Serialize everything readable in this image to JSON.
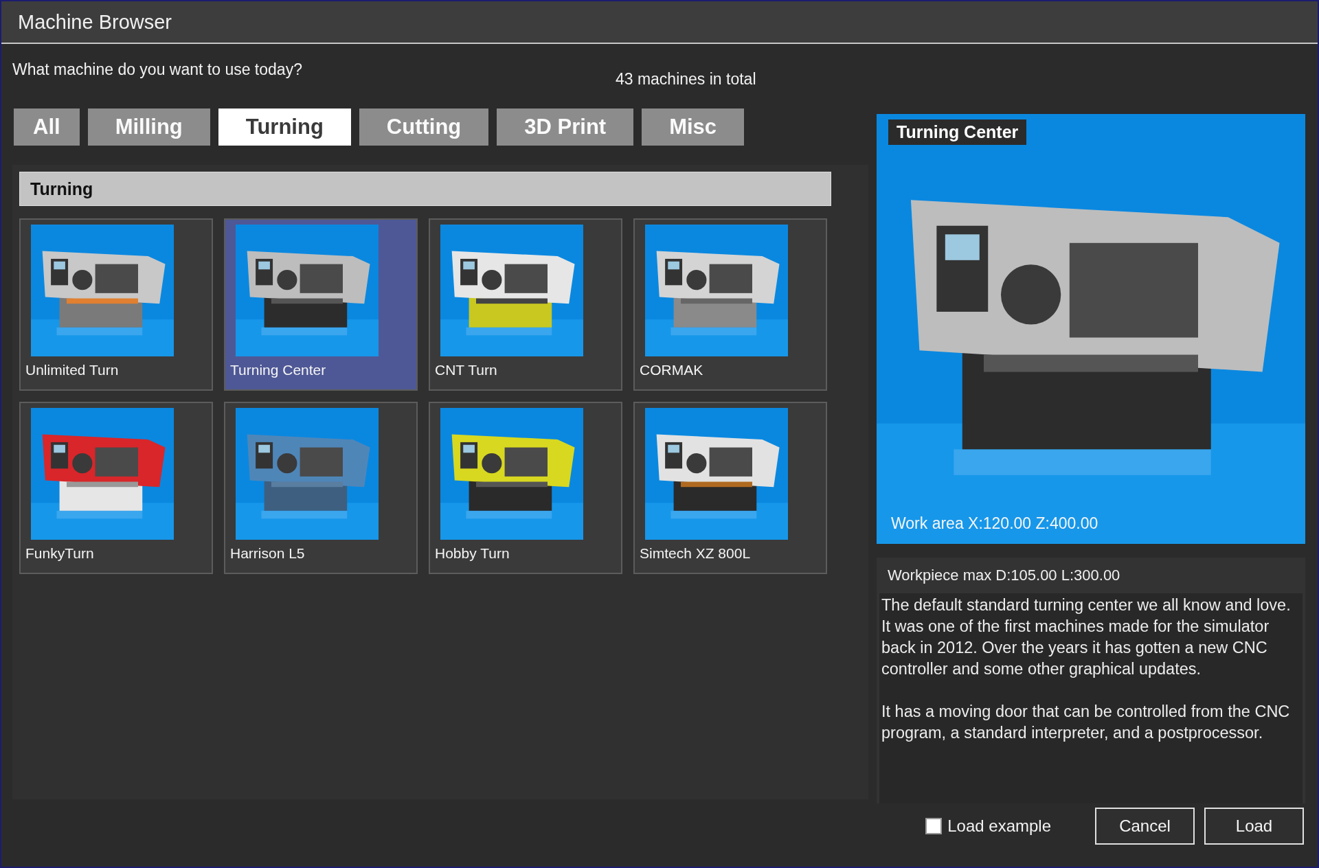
{
  "window": {
    "title": "Machine Browser"
  },
  "prompt": "What machine do you want to use today?",
  "count_label": "43 machines in total",
  "tabs": [
    {
      "label": "All",
      "selected": false
    },
    {
      "label": "Milling",
      "selected": false
    },
    {
      "label": "Turning",
      "selected": true
    },
    {
      "label": "Cutting",
      "selected": false
    },
    {
      "label": "3D Print",
      "selected": false
    },
    {
      "label": "Misc",
      "selected": false
    }
  ],
  "section": {
    "title": "Turning"
  },
  "machines": [
    {
      "name": "Unlimited Turn",
      "selected": false
    },
    {
      "name": "Turning Center",
      "selected": true
    },
    {
      "name": "CNT Turn",
      "selected": false
    },
    {
      "name": "CORMAK",
      "selected": false
    },
    {
      "name": "FunkyTurn",
      "selected": false
    },
    {
      "name": "Harrison L5",
      "selected": false
    },
    {
      "name": "Hobby Turn",
      "selected": false
    },
    {
      "name": "Simtech XZ 800L",
      "selected": false
    }
  ],
  "preview": {
    "title": "Turning Center",
    "work_area": "Work area X:120.00 Z:400.00"
  },
  "workpiece": "Workpiece max D:105.00 L:300.00",
  "description": [
    "The default standard turning center we all know and love. It was one of the first machines made for the simulator back in 2012. Over the years it has gotten a new CNC controller and some other graphical updates.",
    "It has a moving door that can be controlled from the CNC program, a standard interpreter, and a postprocessor."
  ],
  "load_example": {
    "label": "Load example",
    "checked": false
  },
  "buttons": [
    "Cancel",
    "Load"
  ]
}
